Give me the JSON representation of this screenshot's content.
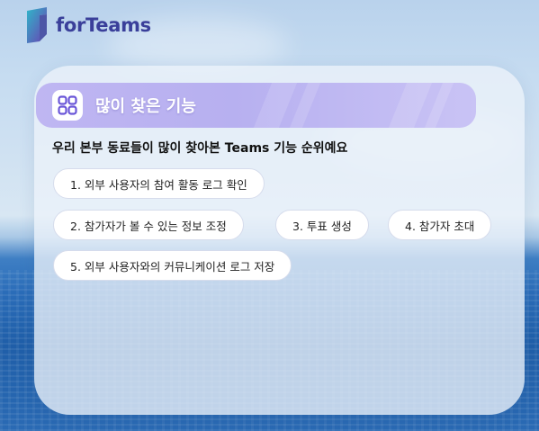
{
  "brand": {
    "logo_text": "forTeams"
  },
  "section": {
    "icon": "grid-apps-icon",
    "title": "많이 찾은 기능",
    "subtitle": "우리 본부 동료들이 많이 찾아본 Teams 기능 순위예요"
  },
  "features": [
    "1. 외부 사용자의 참여 활동 로그 확인",
    "2. 참가자가 볼 수 있는 정보 조정",
    "3. 투표 생성",
    "4. 참가자 초대",
    "5. 외부 사용자와의 커뮤니케이션 로그 저장"
  ],
  "colors": {
    "accent": "#b9b1f1",
    "brand": "#3a3f9a"
  }
}
